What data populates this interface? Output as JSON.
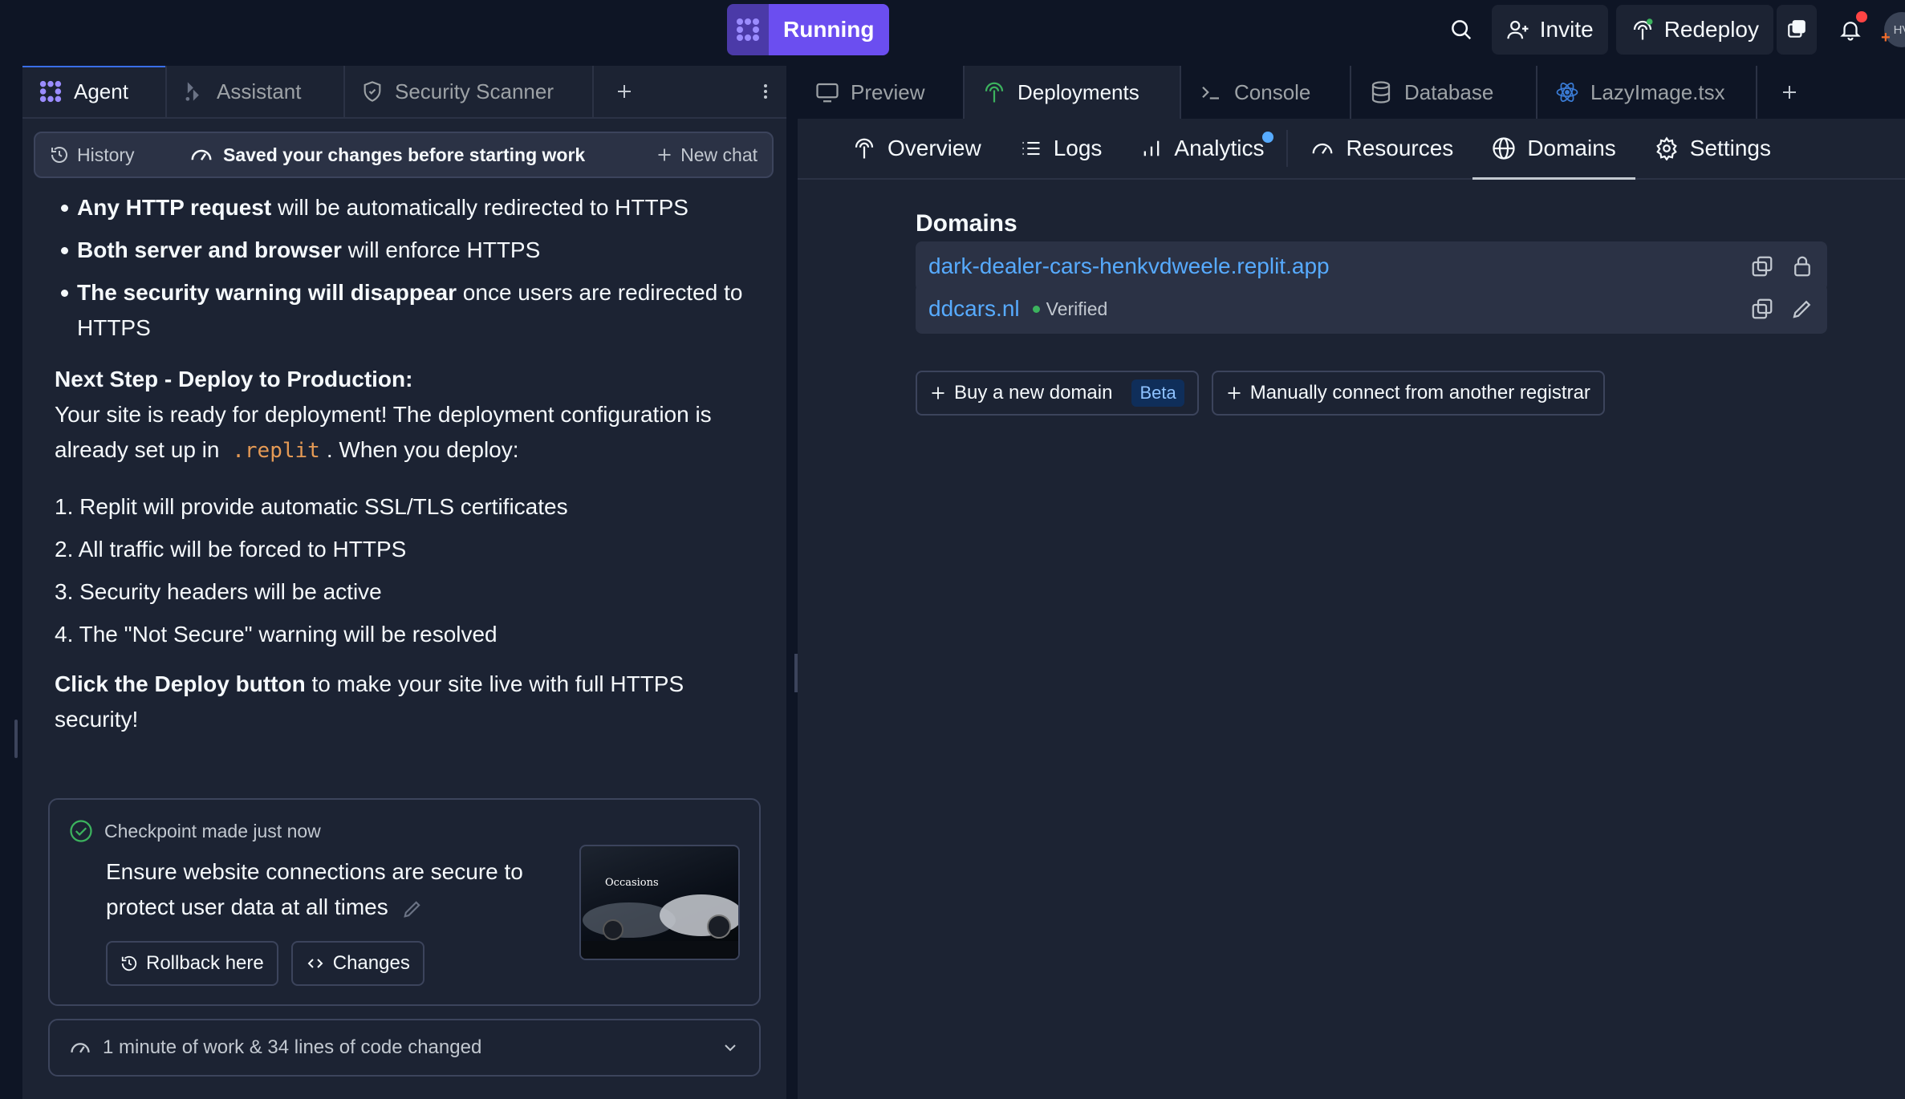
{
  "topbar": {
    "run_label": "Running",
    "invite_label": "Invite",
    "redeploy_label": "Redeploy",
    "avatar_initials": "HV"
  },
  "left_tabs": [
    {
      "label": "Agent",
      "icon": "agent-icon",
      "active": true
    },
    {
      "label": "Assistant",
      "icon": "assistant-icon",
      "active": false
    },
    {
      "label": "Security Scanner",
      "icon": "shield-icon",
      "active": false
    }
  ],
  "chatbar": {
    "history_label": "History",
    "status_text": "Saved your changes before starting work",
    "new_chat_label": "New chat"
  },
  "message": {
    "bullets": [
      {
        "bold": "Any HTTP request",
        "rest": " will be automatically redirected to HTTPS"
      },
      {
        "bold": "Both server and browser",
        "rest": " will enforce HTTPS"
      },
      {
        "bold": "The security warning will disappear",
        "rest": " once users are redirected to HTTPS"
      }
    ],
    "next_step_heading": "Next Step - Deploy to Production:",
    "next_step_text_1": "Your site is ready for deployment! The deployment configuration is already set up in",
    "next_step_code": ".replit",
    "next_step_text_2": ". When you deploy:",
    "steps": [
      "1. Replit will provide automatic SSL/TLS certificates",
      "2. All traffic will be forced to HTTPS",
      "3. Security headers will be active",
      "4. The \"Not Secure\" warning will be resolved"
    ],
    "cta_bold": "Click the Deploy button",
    "cta_rest": " to make your site live with full HTTPS security!"
  },
  "checkpoint": {
    "label": "Checkpoint made",
    "time": "just now",
    "description": "Ensure website connections are secure to protect user data at all times",
    "rollback_label": "Rollback here",
    "changes_label": "Changes",
    "thumb_text": "Occasions"
  },
  "work_summary": "1 minute of work & 34 lines of code changed",
  "right_tabs": [
    {
      "label": "Preview",
      "icon": "monitor-icon",
      "active": false
    },
    {
      "label": "Deployments",
      "icon": "deploy-icon",
      "active": true
    },
    {
      "label": "Console",
      "icon": "terminal-icon",
      "active": false
    },
    {
      "label": "Database",
      "icon": "database-icon",
      "active": false
    },
    {
      "label": "LazyImage.tsx",
      "icon": "react-icon",
      "active": false
    }
  ],
  "sub_tabs": [
    {
      "label": "Overview",
      "active": false
    },
    {
      "label": "Logs",
      "active": false
    },
    {
      "label": "Analytics",
      "active": false,
      "badge_dot": true
    },
    {
      "label": "Resources",
      "active": false
    },
    {
      "label": "Domains",
      "active": true
    },
    {
      "label": "Settings",
      "active": false
    }
  ],
  "domains": {
    "title": "Domains",
    "list": [
      {
        "host": "dark-dealer-cars-henkvdweele.replit.app",
        "status": ""
      },
      {
        "host": "ddcars.nl",
        "status": "Verified"
      }
    ],
    "buy_label": "Buy a new domain",
    "beta_label": "Beta",
    "connect_label": "Manually connect from another registrar"
  },
  "colors": {
    "accent": "#6b4ef0",
    "link": "#57abff",
    "verified": "#3cb35e",
    "code": "#e59a55",
    "notif": "#ff4444"
  }
}
